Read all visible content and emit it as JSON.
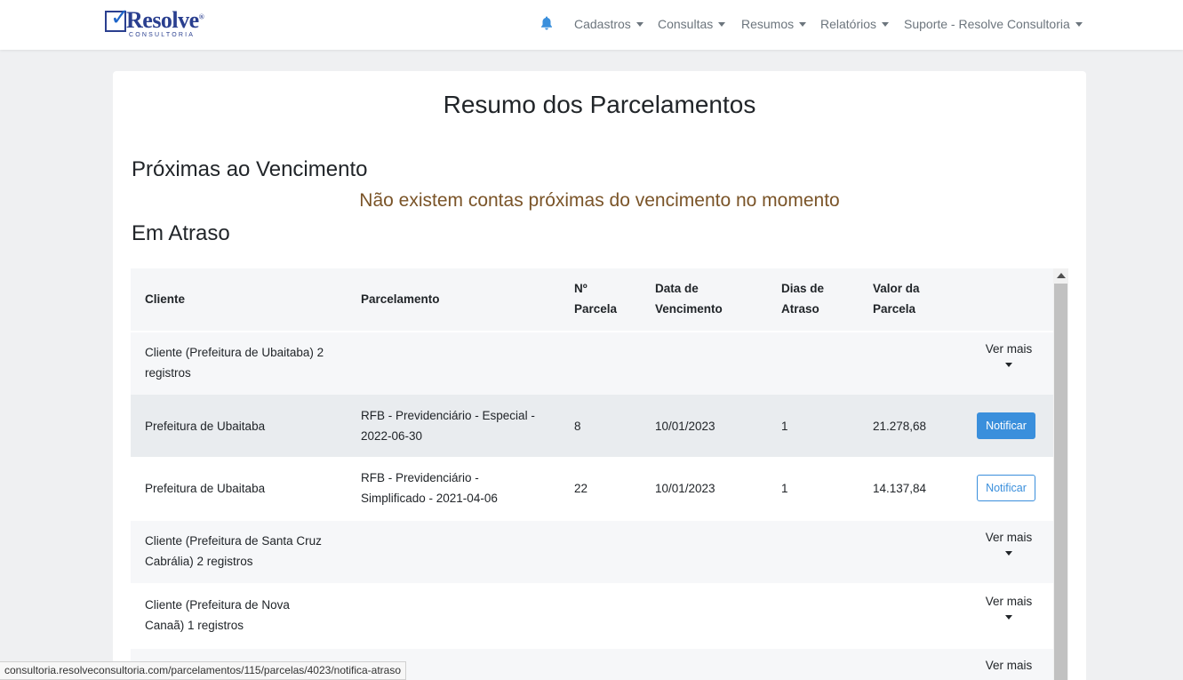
{
  "brand": {
    "name": "Resolve",
    "reg": "®",
    "subtitle": "CONSULTORIA"
  },
  "nav": {
    "items": [
      {
        "label": "Cadastros"
      },
      {
        "label": "Consultas"
      },
      {
        "label": "Resumos"
      },
      {
        "label": "Relatórios"
      },
      {
        "label": "Suporte - Resolve Consultoria"
      }
    ]
  },
  "page": {
    "title": "Resumo dos Parcelamentos",
    "upcoming_heading": "Próximas ao Vencimento",
    "upcoming_empty": "Não existem contas próximas do vencimento no momento",
    "overdue_heading": "Em Atraso"
  },
  "table": {
    "headers": {
      "cliente": "Cliente",
      "parcelamento": "Parcelamento",
      "parcela_l1": "Nº",
      "parcela_l2": "Parcela",
      "venc_l1": "Data de",
      "venc_l2": "Vencimento",
      "dias_l1": "Dias de",
      "dias_l2": "Atraso",
      "valor_l1": "Valor da",
      "valor_l2": "Parcela"
    },
    "ver_mais_label": "Ver mais",
    "notify_label": "Notificar",
    "groups": [
      {
        "l1": "Cliente (Prefeitura de Ubaitaba) 2",
        "l2": "registros"
      },
      {
        "l1": "Cliente (Prefeitura de Santa Cruz",
        "l2": "Cabrália) 2 registros"
      },
      {
        "l1": "Cliente (Prefeitura de Nova",
        "l2": "Canaã) 1 registros"
      }
    ],
    "rows": [
      {
        "cliente": "Prefeitura de Ubaitaba",
        "parc_l1": "RFB - Previdenciário - Especial -",
        "parc_l2": "2022-06-30",
        "numero": "8",
        "vencimento": "10/01/2023",
        "dias": "1",
        "valor": "21.278,68"
      },
      {
        "cliente": "Prefeitura de Ubaitaba",
        "parc_l1": "RFB - Previdenciário -",
        "parc_l2": "Simplificado - 2021-04-06",
        "numero": "22",
        "vencimento": "10/01/2023",
        "dias": "1",
        "valor": "14.137,84"
      }
    ]
  },
  "status_url": "consultoria.resolveconsultoria.com/parcelamentos/115/parcelas/4023/notifica-atraso",
  "colors": {
    "accent": "#3a8fdc",
    "brand": "#2a3f8f",
    "empty_msg": "#7a5428"
  }
}
